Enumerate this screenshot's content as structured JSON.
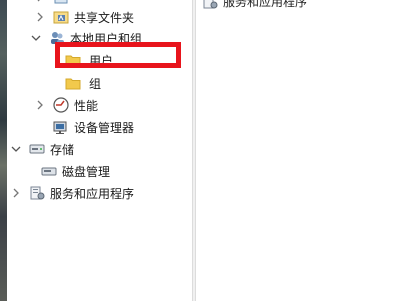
{
  "tree": {
    "partial_item": "",
    "shared_folders": "共享文件夹",
    "local_users_groups": "本地用户和组",
    "users": "用户",
    "groups": "组",
    "performance": "性能",
    "device_manager": "设备管理器",
    "storage": "存储",
    "disk_management": "磁盘管理",
    "services_apps": "服务和应用程序"
  },
  "right_pane": {
    "header_item": "服务和应用程序"
  },
  "colors": {
    "highlight": "#e8141c",
    "folder": "#f2c94c"
  }
}
